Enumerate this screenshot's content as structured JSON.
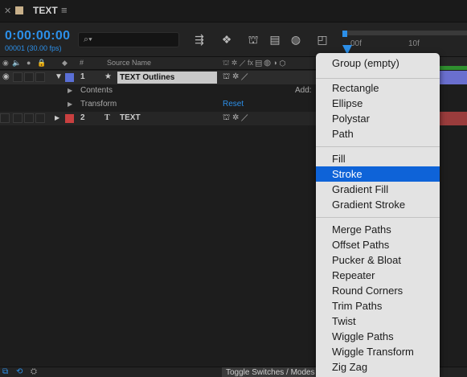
{
  "panel": {
    "title": "TEXT"
  },
  "toolbar": {
    "timecode": "0:00:00:00",
    "fps": "00001 (30.00 fps)",
    "search_placeholder": ""
  },
  "ruler": {
    "tick1": "00f",
    "tick2": "10f"
  },
  "header": {
    "num": "#",
    "source_name": "Source Name"
  },
  "layers": [
    {
      "num": "1",
      "name": "TEXT Outlines",
      "label_color": "#5a6fd6"
    },
    {
      "num": "2",
      "name": "TEXT",
      "label_color": "#c94040"
    }
  ],
  "properties": {
    "contents": "Contents",
    "add_label": "Add:",
    "transform": "Transform",
    "reset": "Reset"
  },
  "footer": {
    "toggle": "Toggle Switches / Modes"
  },
  "menu": {
    "items": [
      "Group (empty)",
      "Rectangle",
      "Ellipse",
      "Polystar",
      "Path",
      "Fill",
      "Stroke",
      "Gradient Fill",
      "Gradient Stroke",
      "Merge Paths",
      "Offset Paths",
      "Pucker & Bloat",
      "Repeater",
      "Round Corners",
      "Trim Paths",
      "Twist",
      "Wiggle Paths",
      "Wiggle Transform",
      "Zig Zag"
    ],
    "selected": "Stroke"
  }
}
